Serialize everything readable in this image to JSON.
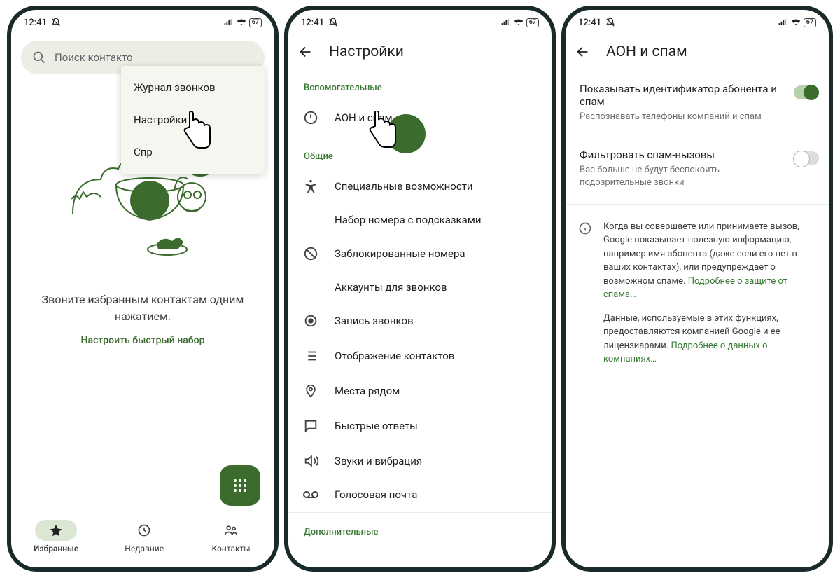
{
  "status": {
    "time": "12:41",
    "battery": "67"
  },
  "screen1": {
    "search_placeholder": "Поиск контакто",
    "menu": {
      "items": [
        "Журнал звонков",
        "Настройки",
        "Спр"
      ]
    },
    "promo": {
      "text": "Звоните избранным контактам одним нажатием.",
      "link": "Настроить быстрый набор"
    },
    "nav": [
      {
        "label": "Избранные",
        "active": true
      },
      {
        "label": "Недавние",
        "active": false
      },
      {
        "label": "Контакты",
        "active": false
      }
    ]
  },
  "screen2": {
    "title": "Настройки",
    "section_aux": "Вспомогательные",
    "item_caller_id": "АОН и спам",
    "section_general": "Общие",
    "items_general": [
      "Специальные возможности",
      "Набор номера с подсказками",
      "Заблокированные номера",
      "Аккаунты для звонков",
      "Запись звонков",
      "Отображение контактов",
      "Места рядом",
      "Быстрые ответы",
      "Звуки и вибрация",
      "Голосовая почта"
    ],
    "section_extra": "Дополнительные"
  },
  "screen3": {
    "title": "АОН и спам",
    "toggle1": {
      "title": "Показывать идентификатор абонента и спам",
      "sub": "Распознавать телефоны компаний и спам",
      "on": true
    },
    "toggle2": {
      "title": "Фильтровать спам-вызовы",
      "sub": "Вас больше не будут беспокоить подозрительные звонки",
      "on": false
    },
    "info": {
      "p1": "Когда вы совершаете или принимаете вызов, Google показывает полезную информацию, например имя абонента (даже если его нет в ваших контактах), или предупреждает о возможном спаме.",
      "link1": "Подробнее о защите от спама…",
      "p2": "Данные, используемые в этих функциях, предоставляются компанией Google и ее лицензиарами.",
      "link2": "Подробнее о данных о компаниях…"
    }
  }
}
